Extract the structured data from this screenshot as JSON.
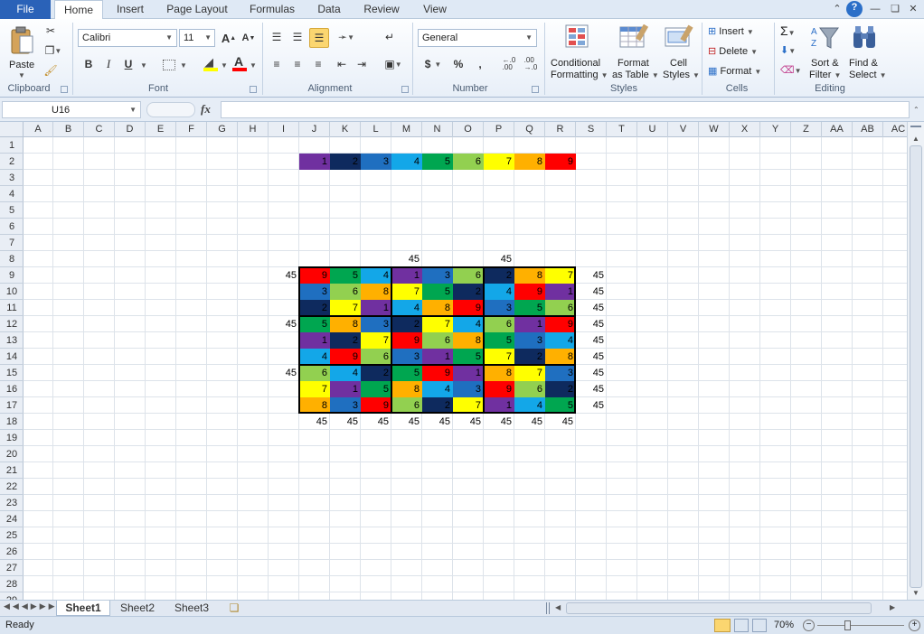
{
  "ribbon_tabs": {
    "file": "File",
    "tabs": [
      "Home",
      "Insert",
      "Page Layout",
      "Formulas",
      "Data",
      "Review",
      "View"
    ],
    "active": "Home"
  },
  "clipboard": {
    "paste": "Paste",
    "group": "Clipboard"
  },
  "font": {
    "name": "Calibri",
    "size": "11",
    "bold": "B",
    "italic": "I",
    "underline": "U",
    "grow": "A",
    "shrink": "A",
    "font_color": "A",
    "group": "Font"
  },
  "alignment": {
    "group": "Alignment"
  },
  "number": {
    "format": "General",
    "currency": "$",
    "percent": "%",
    "comma": ",",
    "inc_decimal": "←.0\n.00",
    "dec_decimal": ".00\n→.0",
    "group": "Number"
  },
  "styles": {
    "conditional": [
      "Conditional",
      "Formatting"
    ],
    "format_table": [
      "Format",
      "as Table"
    ],
    "cell_styles": [
      "Cell",
      "Styles"
    ],
    "group": "Styles"
  },
  "cells_grp": {
    "insert": "Insert",
    "delete": "Delete",
    "format": "Format",
    "group": "Cells"
  },
  "editing": {
    "sum": "Σ",
    "sort": [
      "Sort &",
      "Filter"
    ],
    "find": [
      "Find &",
      "Select"
    ],
    "group": "Editing"
  },
  "formula_bar": {
    "name_box": "U16",
    "fx": "fx",
    "formula": ""
  },
  "columns": [
    "A",
    "B",
    "C",
    "D",
    "E",
    "F",
    "G",
    "H",
    "I",
    "J",
    "K",
    "L",
    "M",
    "N",
    "O",
    "P",
    "Q",
    "R",
    "S",
    "T",
    "U",
    "V",
    "W",
    "X",
    "Y",
    "Z",
    "AA",
    "AB",
    "AC"
  ],
  "rows": [
    "1",
    "2",
    "3",
    "4",
    "5",
    "6",
    "7",
    "8",
    "9",
    "10",
    "11",
    "12",
    "13",
    "14",
    "15",
    "16",
    "17",
    "18",
    "19",
    "20",
    "21",
    "22",
    "23",
    "24",
    "25",
    "26",
    "27",
    "28",
    "29"
  ],
  "palette_colors": {
    "1": "#7030a0",
    "2": "#0e2a5e",
    "3": "#1f6fc0",
    "4": "#13a7e8",
    "5": "#00a650",
    "6": "#92d050",
    "7": "#ffff00",
    "8": "#ffb000",
    "9": "#ff0000"
  },
  "legend_row": [
    "1",
    "2",
    "3",
    "4",
    "5",
    "6",
    "7",
    "8",
    "9"
  ],
  "top_sums": {
    "M": "45",
    "P": "45"
  },
  "left_sums": {
    "9": "45",
    "12": "45",
    "15": "45"
  },
  "right_sums": [
    "45",
    "45",
    "45",
    "45",
    "45",
    "45",
    "45",
    "45",
    "45"
  ],
  "bottom_sums": [
    "45",
    "45",
    "45",
    "45",
    "45",
    "45",
    "45",
    "45",
    "45"
  ],
  "sudoku": [
    [
      "9",
      "5",
      "4",
      "1",
      "3",
      "6",
      "2",
      "8",
      "7"
    ],
    [
      "3",
      "6",
      "8",
      "7",
      "5",
      "2",
      "4",
      "9",
      "1"
    ],
    [
      "2",
      "7",
      "1",
      "4",
      "8",
      "9",
      "3",
      "5",
      "6"
    ],
    [
      "5",
      "8",
      "3",
      "2",
      "7",
      "4",
      "6",
      "1",
      "9"
    ],
    [
      "1",
      "2",
      "7",
      "9",
      "6",
      "8",
      "5",
      "3",
      "4"
    ],
    [
      "4",
      "9",
      "6",
      "3",
      "1",
      "5",
      "7",
      "2",
      "8"
    ],
    [
      "6",
      "4",
      "2",
      "5",
      "9",
      "1",
      "8",
      "7",
      "3"
    ],
    [
      "7",
      "1",
      "5",
      "8",
      "4",
      "3",
      "9",
      "6",
      "2"
    ],
    [
      "8",
      "3",
      "9",
      "6",
      "2",
      "7",
      "1",
      "4",
      "5"
    ]
  ],
  "sheets": [
    "Sheet1",
    "Sheet2",
    "Sheet3"
  ],
  "active_sheet": "Sheet1",
  "status": {
    "ready": "Ready",
    "zoom": "70%"
  }
}
